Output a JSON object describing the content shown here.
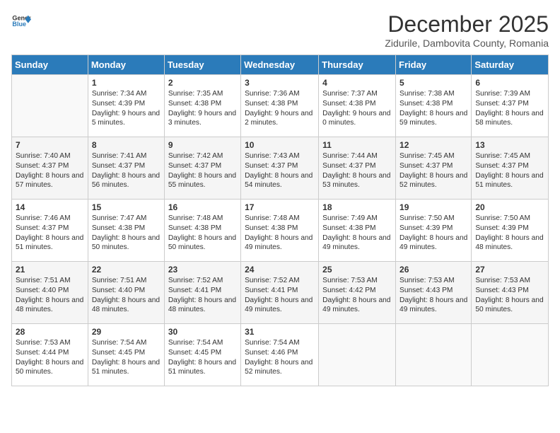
{
  "logo": {
    "general": "General",
    "blue": "Blue"
  },
  "title": "December 2025",
  "subtitle": "Zidurile, Dambovita County, Romania",
  "headers": [
    "Sunday",
    "Monday",
    "Tuesday",
    "Wednesday",
    "Thursday",
    "Friday",
    "Saturday"
  ],
  "weeks": [
    [
      null,
      {
        "day": "1",
        "sunrise": "7:34 AM",
        "sunset": "4:39 PM",
        "daylight": "9 hours and 5 minutes."
      },
      {
        "day": "2",
        "sunrise": "7:35 AM",
        "sunset": "4:38 PM",
        "daylight": "9 hours and 3 minutes."
      },
      {
        "day": "3",
        "sunrise": "7:36 AM",
        "sunset": "4:38 PM",
        "daylight": "9 hours and 2 minutes."
      },
      {
        "day": "4",
        "sunrise": "7:37 AM",
        "sunset": "4:38 PM",
        "daylight": "9 hours and 0 minutes."
      },
      {
        "day": "5",
        "sunrise": "7:38 AM",
        "sunset": "4:38 PM",
        "daylight": "8 hours and 59 minutes."
      },
      {
        "day": "6",
        "sunrise": "7:39 AM",
        "sunset": "4:37 PM",
        "daylight": "8 hours and 58 minutes."
      }
    ],
    [
      {
        "day": "7",
        "sunrise": "7:40 AM",
        "sunset": "4:37 PM",
        "daylight": "8 hours and 57 minutes."
      },
      {
        "day": "8",
        "sunrise": "7:41 AM",
        "sunset": "4:37 PM",
        "daylight": "8 hours and 56 minutes."
      },
      {
        "day": "9",
        "sunrise": "7:42 AM",
        "sunset": "4:37 PM",
        "daylight": "8 hours and 55 minutes."
      },
      {
        "day": "10",
        "sunrise": "7:43 AM",
        "sunset": "4:37 PM",
        "daylight": "8 hours and 54 minutes."
      },
      {
        "day": "11",
        "sunrise": "7:44 AM",
        "sunset": "4:37 PM",
        "daylight": "8 hours and 53 minutes."
      },
      {
        "day": "12",
        "sunrise": "7:45 AM",
        "sunset": "4:37 PM",
        "daylight": "8 hours and 52 minutes."
      },
      {
        "day": "13",
        "sunrise": "7:45 AM",
        "sunset": "4:37 PM",
        "daylight": "8 hours and 51 minutes."
      }
    ],
    [
      {
        "day": "14",
        "sunrise": "7:46 AM",
        "sunset": "4:37 PM",
        "daylight": "8 hours and 51 minutes."
      },
      {
        "day": "15",
        "sunrise": "7:47 AM",
        "sunset": "4:38 PM",
        "daylight": "8 hours and 50 minutes."
      },
      {
        "day": "16",
        "sunrise": "7:48 AM",
        "sunset": "4:38 PM",
        "daylight": "8 hours and 50 minutes."
      },
      {
        "day": "17",
        "sunrise": "7:48 AM",
        "sunset": "4:38 PM",
        "daylight": "8 hours and 49 minutes."
      },
      {
        "day": "18",
        "sunrise": "7:49 AM",
        "sunset": "4:38 PM",
        "daylight": "8 hours and 49 minutes."
      },
      {
        "day": "19",
        "sunrise": "7:50 AM",
        "sunset": "4:39 PM",
        "daylight": "8 hours and 49 minutes."
      },
      {
        "day": "20",
        "sunrise": "7:50 AM",
        "sunset": "4:39 PM",
        "daylight": "8 hours and 48 minutes."
      }
    ],
    [
      {
        "day": "21",
        "sunrise": "7:51 AM",
        "sunset": "4:40 PM",
        "daylight": "8 hours and 48 minutes."
      },
      {
        "day": "22",
        "sunrise": "7:51 AM",
        "sunset": "4:40 PM",
        "daylight": "8 hours and 48 minutes."
      },
      {
        "day": "23",
        "sunrise": "7:52 AM",
        "sunset": "4:41 PM",
        "daylight": "8 hours and 48 minutes."
      },
      {
        "day": "24",
        "sunrise": "7:52 AM",
        "sunset": "4:41 PM",
        "daylight": "8 hours and 49 minutes."
      },
      {
        "day": "25",
        "sunrise": "7:53 AM",
        "sunset": "4:42 PM",
        "daylight": "8 hours and 49 minutes."
      },
      {
        "day": "26",
        "sunrise": "7:53 AM",
        "sunset": "4:43 PM",
        "daylight": "8 hours and 49 minutes."
      },
      {
        "day": "27",
        "sunrise": "7:53 AM",
        "sunset": "4:43 PM",
        "daylight": "8 hours and 50 minutes."
      }
    ],
    [
      {
        "day": "28",
        "sunrise": "7:53 AM",
        "sunset": "4:44 PM",
        "daylight": "8 hours and 50 minutes."
      },
      {
        "day": "29",
        "sunrise": "7:54 AM",
        "sunset": "4:45 PM",
        "daylight": "8 hours and 51 minutes."
      },
      {
        "day": "30",
        "sunrise": "7:54 AM",
        "sunset": "4:45 PM",
        "daylight": "8 hours and 51 minutes."
      },
      {
        "day": "31",
        "sunrise": "7:54 AM",
        "sunset": "4:46 PM",
        "daylight": "8 hours and 52 minutes."
      },
      null,
      null,
      null
    ]
  ]
}
